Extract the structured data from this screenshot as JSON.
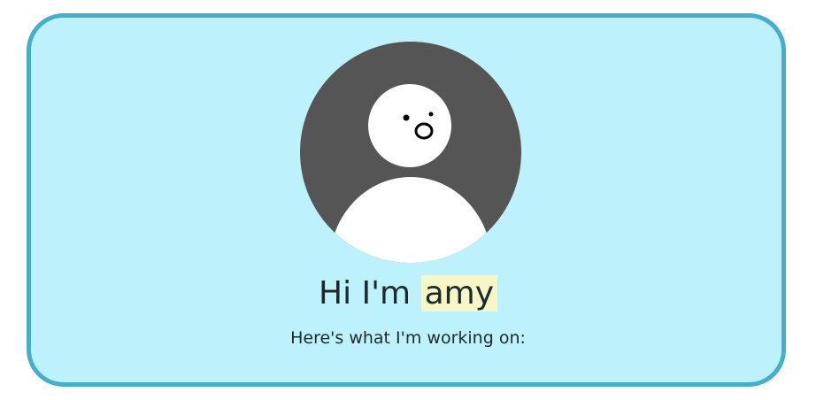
{
  "profile": {
    "greeting_prefix": "Hi I'm",
    "name": "amy",
    "subtitle": "Here's what I'm working on:"
  },
  "avatar": {
    "icon": "default-user-avatar-icon"
  },
  "colors": {
    "card_background": "#bdf1fc",
    "card_border": "#44aecb",
    "avatar_background": "#555555",
    "name_highlight": "#f7f6c7",
    "text": "#1c2a2e"
  }
}
